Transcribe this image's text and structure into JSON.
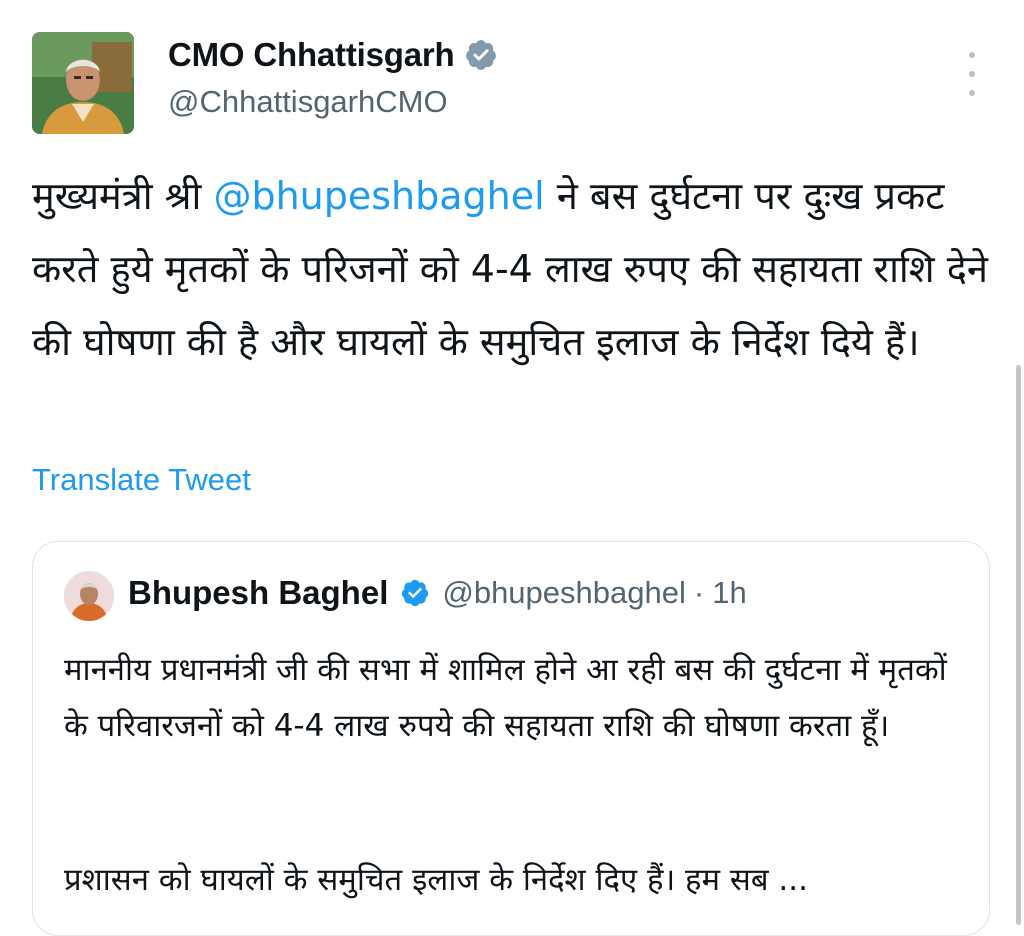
{
  "tweet": {
    "author": {
      "display_name": "CMO Chhattisgarh",
      "handle": "@ChhattisgarhCMO",
      "verified": true
    },
    "text_before_mention": "मुख्यमंत्री श्री ",
    "mention": "@bhupeshbaghel",
    "text_after_mention": " ने बस दुर्घटना पर दुःख प्रकट करते हुये मृतकों के परिजनों को 4-4 लाख रुपए की सहायता राशि देने की घोषणा की है और घायलों के समुचित इलाज के निर्देश दिये हैं।",
    "translate_label": "Translate Tweet",
    "more_icon": "more-vertical-icon"
  },
  "quoted_tweet": {
    "author": {
      "display_name": "Bhupesh Baghel",
      "handle": "@bhupeshbaghel",
      "verified": true
    },
    "separator": "·",
    "time": "1h",
    "paragraph1": "माननीय प्रधानमंत्री जी की सभा में शामिल होने आ रही बस की दुर्घटना में मृतकों के परिवारजनों को 4-4 लाख रुपये की सहायता राशि की घोषणा करता हूँ।",
    "paragraph2": "प्रशासन को घायलों के समुचित इलाज के निर्देश दिए हैं। हम सब ..."
  },
  "colors": {
    "accent": "#1d9bf0",
    "text": "#0f1419",
    "secondary_text": "#536471",
    "verified_badge": "#829aab"
  }
}
